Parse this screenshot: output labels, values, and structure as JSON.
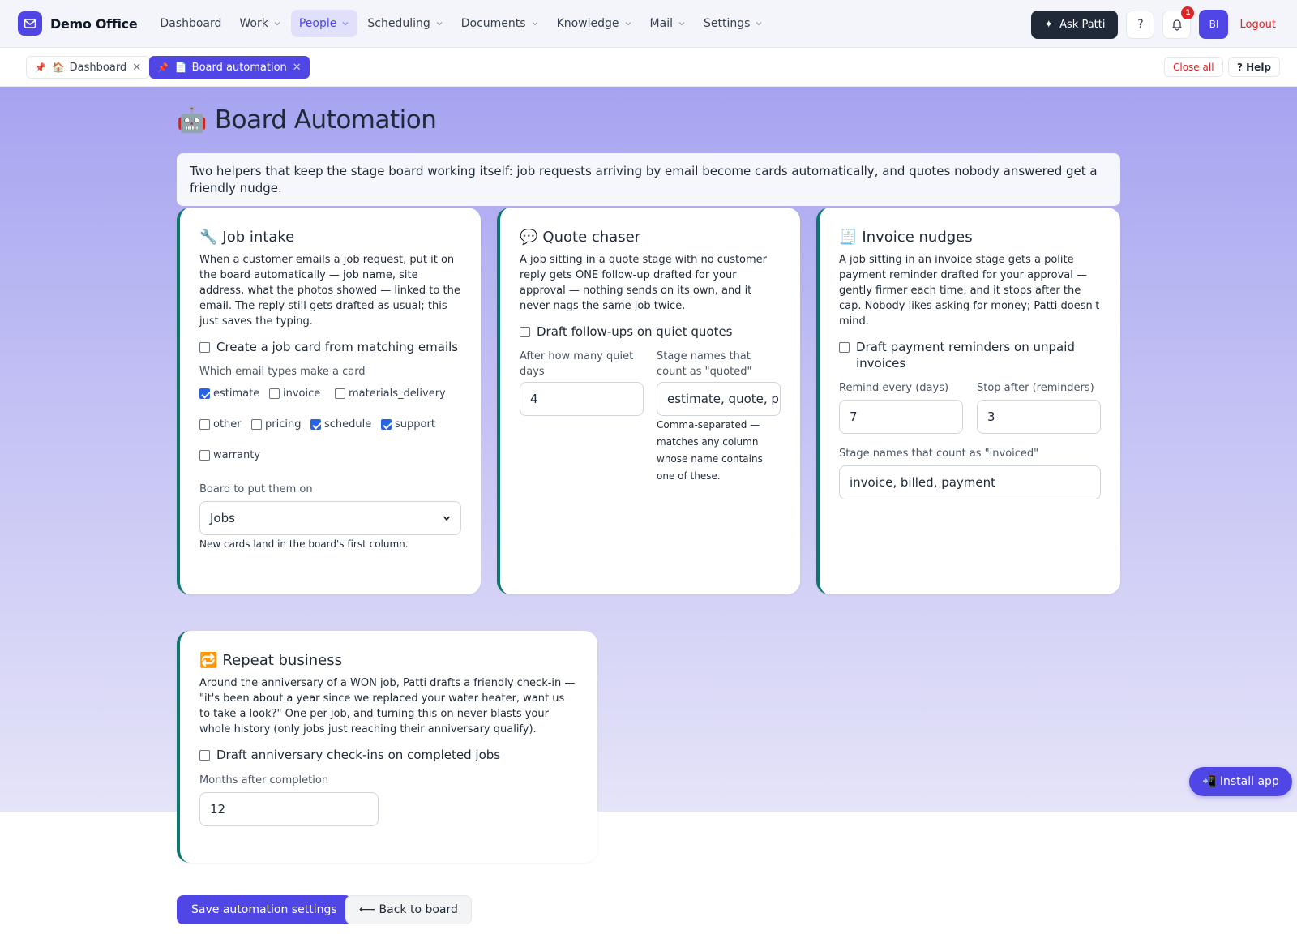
{
  "app": {
    "name": "Demo Office"
  },
  "nav": {
    "items": [
      {
        "label": "Dashboard",
        "has_menu": false
      },
      {
        "label": "Work",
        "has_menu": true
      },
      {
        "label": "People",
        "has_menu": true,
        "active": true
      },
      {
        "label": "Scheduling",
        "has_menu": true
      },
      {
        "label": "Documents",
        "has_menu": true
      },
      {
        "label": "Knowledge",
        "has_menu": true
      },
      {
        "label": "Mail",
        "has_menu": true
      },
      {
        "label": "Settings",
        "has_menu": true
      }
    ],
    "ask_label": "Ask Patti",
    "help_icon_label": "?",
    "notification_count": "1",
    "avatar_initials": "BI",
    "logout_label": "Logout"
  },
  "tabs": {
    "items": [
      {
        "pin": "📌",
        "icon": "🏠",
        "label": "Dashboard",
        "close": "✕"
      },
      {
        "pin": "📌",
        "icon": "📄",
        "label": "Board automation",
        "close": "✕"
      }
    ],
    "close_all_label": "Close all",
    "help_label": "? Help"
  },
  "page": {
    "title_icon": "🤖",
    "title": "Board Automation",
    "intro": "Two helpers that keep the stage board working itself: job requests arriving by email become cards automatically, and quotes nobody answered get a friendly nudge."
  },
  "job_intake": {
    "icon": "🔧",
    "title": "Job intake",
    "description": "When a customer emails a job request, put it on the board automatically — job name, site address, what the photos showed — linked to the email. The reply still gets drafted as usual; this just saves the typing.",
    "enable_label": "Create a job card from matching emails",
    "enabled": false,
    "types_label": "Which email types make a card",
    "types": [
      {
        "label": "estimate",
        "checked": true
      },
      {
        "label": "invoice",
        "checked": false
      },
      {
        "label": "materials_delivery",
        "checked": false
      },
      {
        "label": "other",
        "checked": false
      },
      {
        "label": "pricing",
        "checked": false
      },
      {
        "label": "schedule",
        "checked": true
      },
      {
        "label": "support",
        "checked": true
      },
      {
        "label": "warranty",
        "checked": false
      }
    ],
    "board_label": "Board to put them on",
    "board_value": "Jobs",
    "board_hint": "New cards land in the board's first column."
  },
  "quote_chaser": {
    "icon": "💬",
    "title": "Quote chaser",
    "description": "A job sitting in a quote stage with no customer reply gets ONE follow-up drafted for your approval — nothing sends on its own, and it never nags the same job twice.",
    "enable_label": "Draft follow-ups on quiet quotes",
    "enabled": false,
    "days_label": "After how many quiet days",
    "days_value": "4",
    "stages_label": "Stage names that count as \"quoted\"",
    "stages_value": "estimate, quote, pr",
    "stages_hint": "Comma-separated — matches any column whose name contains one of these."
  },
  "invoice_nudges": {
    "icon": "🧾",
    "title": "Invoice nudges",
    "description": "A job sitting in an invoice stage gets a polite payment reminder drafted for your approval — gently firmer each time, and it stops after the cap. Nobody likes asking for money; Patti doesn't mind.",
    "enable_label": "Draft payment reminders on unpaid invoices",
    "enabled": false,
    "remind_label": "Remind every (days)",
    "remind_value": "7",
    "stop_label": "Stop after (reminders)",
    "stop_value": "3",
    "stages_label": "Stage names that count as \"invoiced\"",
    "stages_value": "invoice, billed, payment"
  },
  "repeat_business": {
    "icon": "🔁",
    "title": "Repeat business",
    "description": "Around the anniversary of a WON job, Patti drafts a friendly check-in — \"it's been about a year since we replaced your water heater, want us to take a look?\" One per job, and turning this on never blasts your whole history (only jobs just reaching their anniversary qualify).",
    "enable_label": "Draft anniversary check-ins on completed jobs",
    "enabled": false,
    "months_label": "Months after completion",
    "months_value": "12"
  },
  "actions": {
    "save_label": "Save automation settings",
    "back_label": "⟵ Back to board"
  },
  "install": {
    "label": "📲 Install app"
  },
  "colors": {
    "brand": "#4f46e5",
    "card_accent": "#0f766e",
    "danger": "#dc2626",
    "checkbox_on": "#2563eb"
  }
}
